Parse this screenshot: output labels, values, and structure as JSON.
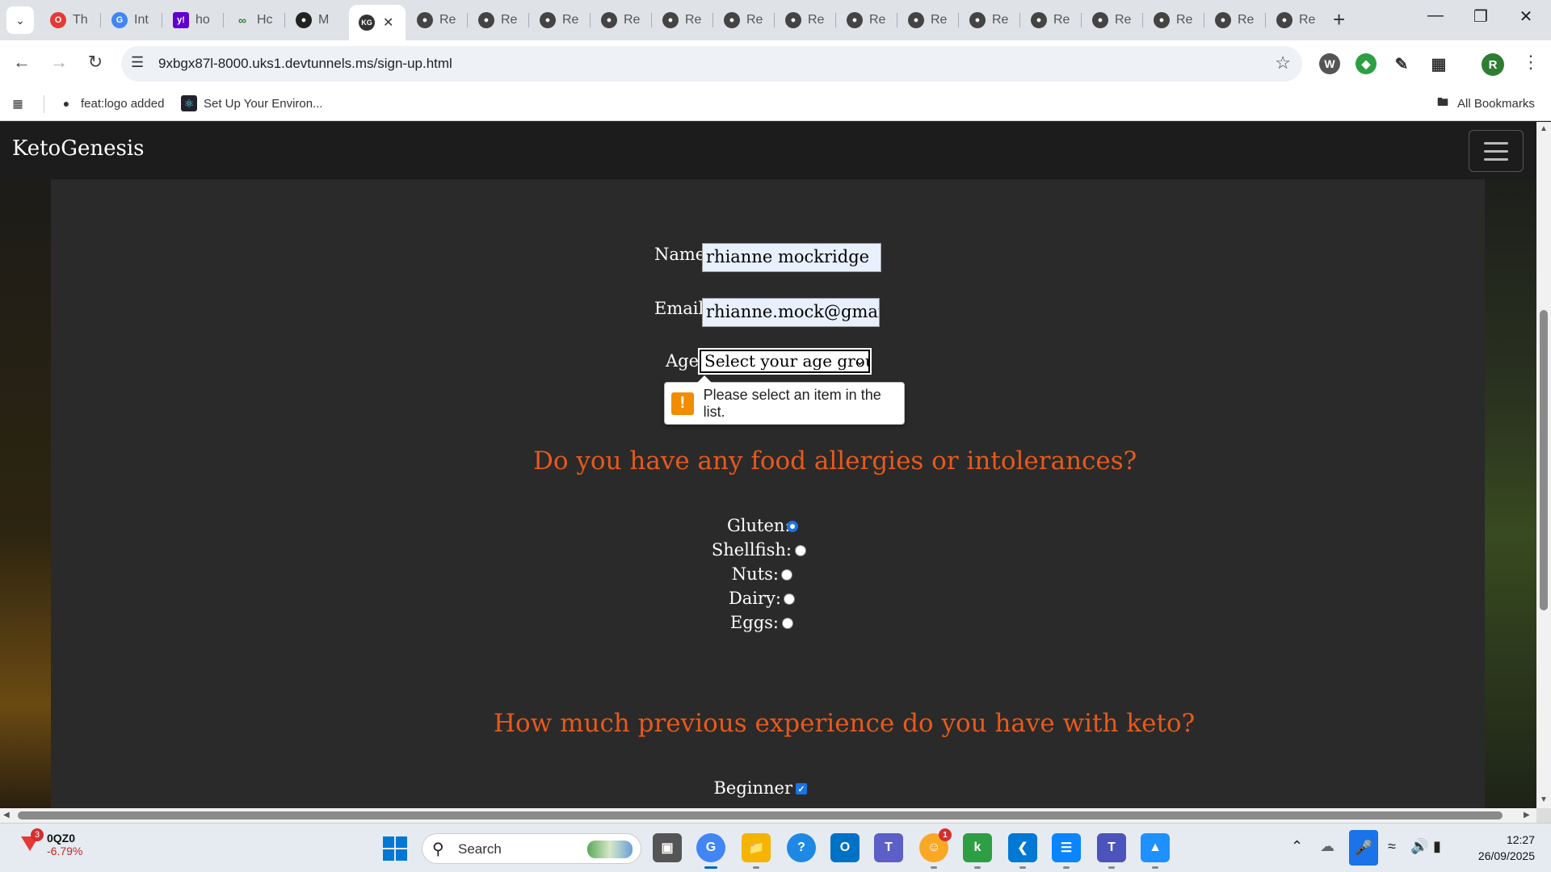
{
  "browser": {
    "tabs": [
      {
        "title": "Th",
        "favicon": "opera-icon",
        "color": "#e53935"
      },
      {
        "title": "Int",
        "favicon": "chrome-icon",
        "color": "#4285f4"
      },
      {
        "title": "ho",
        "favicon": "yahoo-icon",
        "color": "#6001d2"
      },
      {
        "title": "Hc",
        "favicon": "link-icon",
        "color": "#2e7d32"
      },
      {
        "title": "M",
        "favicon": "github-icon",
        "color": "#222222"
      },
      {
        "title": "",
        "favicon": "ketogenesis-icon",
        "color": "#333333"
      },
      {
        "title": "Re",
        "favicon": "globe-icon",
        "color": "#444444"
      },
      {
        "title": "Re",
        "favicon": "globe-icon",
        "color": "#444444"
      },
      {
        "title": "Re",
        "favicon": "globe-icon",
        "color": "#444444"
      },
      {
        "title": "Re",
        "favicon": "globe-icon",
        "color": "#444444"
      },
      {
        "title": "Re",
        "favicon": "globe-icon",
        "color": "#444444"
      },
      {
        "title": "Re",
        "favicon": "globe-icon",
        "color": "#444444"
      },
      {
        "title": "Re",
        "favicon": "globe-icon",
        "color": "#444444"
      },
      {
        "title": "Re",
        "favicon": "globe-icon",
        "color": "#444444"
      },
      {
        "title": "Re",
        "favicon": "globe-icon",
        "color": "#444444"
      },
      {
        "title": "Re",
        "favicon": "globe-icon",
        "color": "#444444"
      },
      {
        "title": "Re",
        "favicon": "globe-icon",
        "color": "#444444"
      },
      {
        "title": "Re",
        "favicon": "globe-icon",
        "color": "#444444"
      },
      {
        "title": "Re",
        "favicon": "globe-icon",
        "color": "#444444"
      },
      {
        "title": "Re",
        "favicon": "globe-icon",
        "color": "#444444"
      },
      {
        "title": "Re",
        "favicon": "globe-icon",
        "color": "#444444"
      }
    ],
    "active_tab_icon": "KG",
    "url": "9xbgx87l-8000.uks1.devtunnels.ms/sign-up.html",
    "profile_initial": "R",
    "bookmarks": [
      {
        "label": "feat:logo added",
        "icon": "github-icon"
      },
      {
        "label": "Set Up Your Environ...",
        "icon": "react-icon"
      }
    ],
    "all_bookmarks_label": "All Bookmarks"
  },
  "site": {
    "brand": "KetoGenesis",
    "form": {
      "name_label": "Name:",
      "name_value": "rhianne mockridge",
      "email_label": "Email:",
      "email_value": "rhianne.mock@gmail.co",
      "age_label": "Age:",
      "age_selected": "Select your age group",
      "validation_message": "Please select an item in the list."
    },
    "allergies": {
      "heading": "Do you have any food allergies or intolerances?",
      "options": [
        {
          "label": "Gluten:",
          "checked": true
        },
        {
          "label": "Shellfish:",
          "checked": false
        },
        {
          "label": "Nuts:",
          "checked": false
        },
        {
          "label": "Dairy:",
          "checked": false
        },
        {
          "label": "Eggs:",
          "checked": false
        }
      ]
    },
    "experience": {
      "heading": "How much previous experience do you have with keto?",
      "options": [
        {
          "label": "Beginner",
          "checked": true
        }
      ]
    },
    "colors": {
      "accent": "#e8591a",
      "panel": "#2a2a2a",
      "nav": "#1c1c1c"
    }
  },
  "taskbar": {
    "stock_symbol": "0QZ0",
    "stock_change": "-6.79%",
    "stock_badge": "3",
    "search_label": "Search",
    "apps": [
      {
        "name": "task-view-icon",
        "active": false
      },
      {
        "name": "chrome-icon",
        "active": true
      },
      {
        "name": "file-explorer-icon",
        "active": false
      },
      {
        "name": "help-icon",
        "active": false
      },
      {
        "name": "outlook-icon",
        "active": false
      },
      {
        "name": "teams-icon",
        "active": false
      },
      {
        "name": "discord-icon",
        "active": false,
        "badge": "1"
      },
      {
        "name": "k-app-icon",
        "active": false
      },
      {
        "name": "vscode-icon",
        "active": false
      },
      {
        "name": "notepad-icon",
        "active": false
      },
      {
        "name": "teams-work-icon",
        "active": false
      },
      {
        "name": "photos-icon",
        "active": false
      }
    ],
    "time": "12:27",
    "date": "26/09/2025"
  }
}
